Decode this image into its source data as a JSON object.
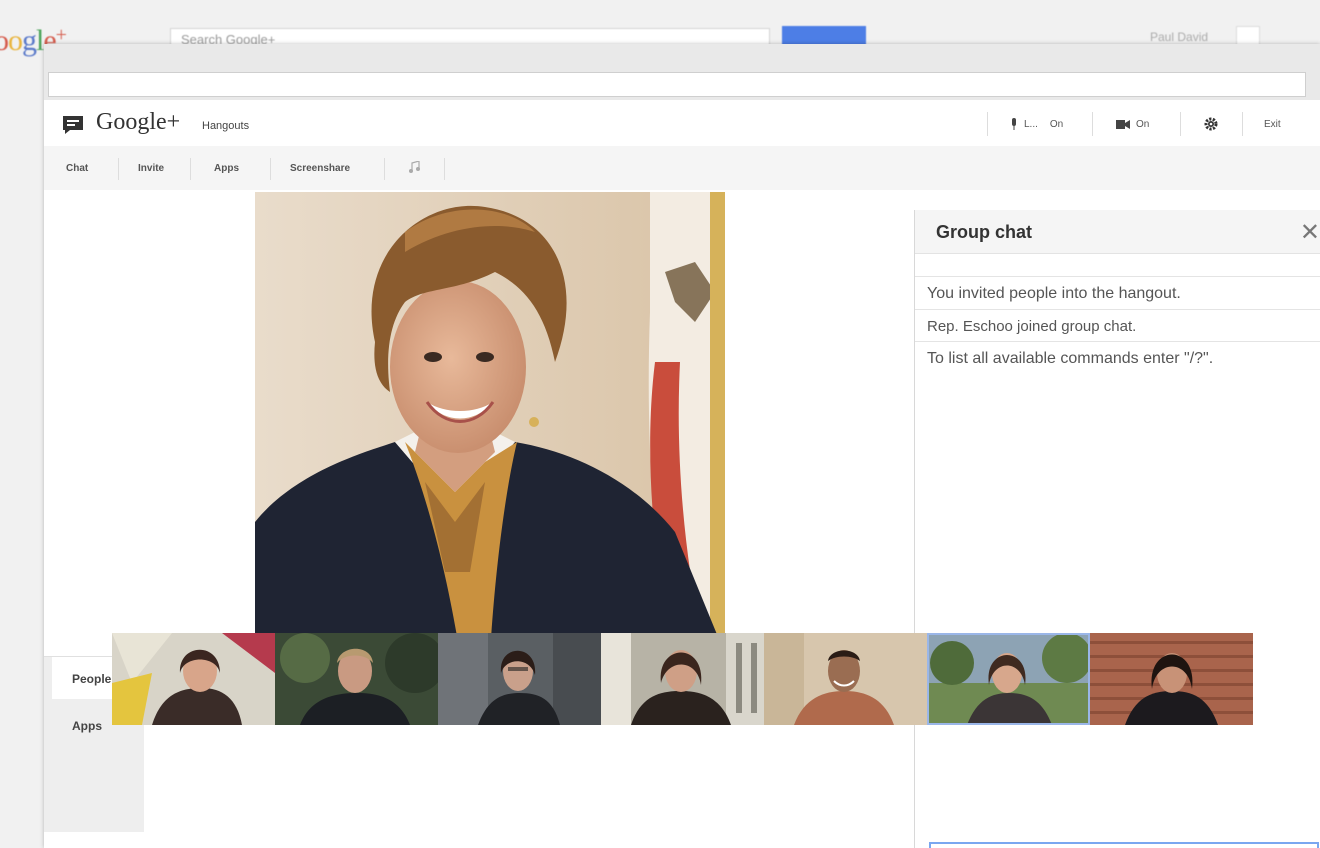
{
  "background": {
    "logo_text": "Google+",
    "search_placeholder": "Search Google+",
    "user_name": "Paul David"
  },
  "header": {
    "brand": "Google+",
    "product": "Hangouts",
    "mic_label": "L...",
    "mic_state": "On",
    "camera_state": "On",
    "exit_label": "Exit"
  },
  "toolbar": {
    "items": [
      "Chat",
      "Invite",
      "Apps",
      "Screenshare"
    ]
  },
  "chat": {
    "title": "Group chat",
    "close": "✕",
    "messages": [
      "You invited people into the hangout.",
      "Rep. Eschoo joined group chat.",
      "To list all available commands enter \"/?\"."
    ]
  },
  "side_tabs": {
    "people": "People",
    "apps": "Apps"
  },
  "colors": {
    "accent_blue": "#4d7ee6",
    "chat_input_border": "#7aa7f0",
    "selected_thumb": "#9ab6e8"
  }
}
